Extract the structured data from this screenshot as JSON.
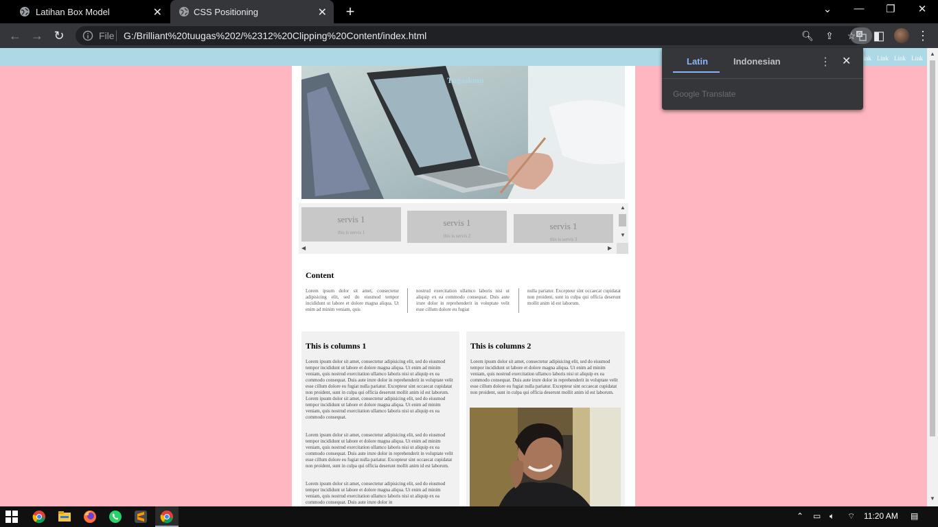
{
  "browser": {
    "tabs": [
      {
        "title": "Latihan Box Model",
        "active": false
      },
      {
        "title": "CSS Positioning",
        "active": true
      }
    ],
    "new_tab": "+",
    "address": {
      "scheme_label": "File",
      "url": "G:/Brilliant%20tuugas%202/%2312%20Clipping%20Content/index.html"
    }
  },
  "translate_popup": {
    "languages": [
      "Latin",
      "Indonesian"
    ],
    "selected": "Latin",
    "footer_google": "Google",
    "footer_translate": "Translate"
  },
  "page": {
    "nav_links": [
      "Link",
      "Link",
      "Link",
      "Link"
    ],
    "brand": "Tugaskmu",
    "services": [
      {
        "title": "servis 1",
        "desc": "this is servis 1"
      },
      {
        "title": "servis 1",
        "desc": "this is servis 2"
      },
      {
        "title": "servis 1",
        "desc": "this is servis 3"
      }
    ],
    "content": {
      "heading": "Content",
      "columns": [
        "Lorem ipsum dolor sit amet, consectetur adipisicing elit, sed do eiusmod tempor incididunt ut labore et dolore magna aliqua. Ut enim ad minim veniam, quis",
        "nostrud exercitation ullamco laboris nisi ut aliquip ex ea commodo consequat. Duis aute irure dolor in reprehenderit in voluptate velit esse cillum dolore eu fugiat",
        "nulla pariatur. Excepteur sint occaecat cupidatat non proident, sunt in culpa qui officia deserunt mollit anim id est laborum."
      ]
    },
    "col1": {
      "heading": "This is columns 1",
      "paragraphs": [
        "Lorem ipsum dolor sit amet, consectetur adipisicing elit, sed do eiusmod tempor incididunt ut labore et dolore magna aliqua. Ut enim ad minim veniam, quis nostrud exercitation ullamco laboris nisi ut aliquip ex ea commodo consequat. Duis aute irure dolor in reprehenderit in voluptate velit esse cillum dolore eu fugiat nulla pariatur. Excepteur sint occaecat cupidatat non proident, sunt in culpa qui officia deserunt mollit anim id est laborum. Lorem ipsum dolor sit amet, consectetur adipisicing elit, sed do eiusmod tempor incididunt ut labore et dolore magna aliqua. Ut enim ad minim veniam, quis nostrud exercitation ullamco laboris nisi ut aliquip ex ea commodo consequat.",
        "Lorem ipsum dolor sit amet, consectetur adipisicing elit, sed do eiusmod tempor incididunt ut labore et dolore magna aliqua. Ut enim ad minim veniam, quis nostrud exercitation ullamco laboris nisi ut aliquip ex ea commodo consequat. Duis aute irure dolor in reprehenderit in voluptate velit esse cillum dolore eu fugiat nulla pariatur. Excepteur sint occaecat cupidatat non proident, sunt in culpa qui officia deserunt mollit anim id est laborum.",
        "Lorem ipsum dolor sit amet, consectetur adipisicing elit, sed do eiusmod tempor incididunt ut labore et dolore magna aliqua. Ut enim ad minim veniam, quis nostrud exercitation ullamco laboris nisi ut aliquip ex ea commodo consequat. Duis aute irure dolor in"
      ]
    },
    "col2": {
      "heading": "This is columns 2",
      "paragraph": "Lorem ipsum dolor sit amet, consectetur adipisicing elit, sed do eiusmod tempor incididunt ut labore et dolore magna aliqua. Ut enim ad minim veniam, quis nostrud exercitation ullamco laboris nisi ut aliquip ex ea commodo consequat. Duis aute irure dolor in reprehenderit in voluptate velit esse cillum dolore eu fugiat nulla pariatur. Excepteur sint occaecat cupidatat non proident, sunt in culpa qui officia deserunt mollit anim id est laborum."
    }
  },
  "taskbar": {
    "time": "11:20 AM"
  },
  "colors": {
    "page_bg": "#ffb6c1",
    "topbar": "#add8e6",
    "chrome_dark": "#35363a",
    "accent": "#8ab4f8"
  }
}
